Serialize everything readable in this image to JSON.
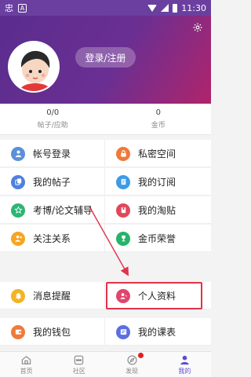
{
  "status_bar": {
    "time": "11:30",
    "app_icon": "忠"
  },
  "profile": {
    "login_label": "登录/注册"
  },
  "stats": [
    {
      "value": "0/0",
      "label": "帖子/应助"
    },
    {
      "value": "0",
      "label": "金币"
    }
  ],
  "menu": {
    "rows": [
      {
        "left": {
          "label": "帐号登录",
          "icon": "user-icon",
          "color": "#5b8fd9"
        },
        "right": {
          "label": "私密空间",
          "icon": "lock-icon",
          "color": "#f07a3a"
        }
      },
      {
        "left": {
          "label": "我的帖子",
          "icon": "copy-icon",
          "color": "#4f7fe0"
        },
        "right": {
          "label": "我的订阅",
          "icon": "book-icon",
          "color": "#3d9be6"
        }
      },
      {
        "left": {
          "label": "考博/论文辅导",
          "icon": "star-icon",
          "color": "#2bb673"
        },
        "right": {
          "label": "我的淘贴",
          "icon": "bookmark-icon",
          "color": "#e0485a"
        }
      },
      {
        "left": {
          "label": "关注关系",
          "icon": "follow-icon",
          "color": "#f5a623"
        },
        "right": {
          "label": "金币荣誉",
          "icon": "trophy-icon",
          "color": "#27b36a"
        }
      },
      {
        "left": {
          "label": "消息提醒",
          "icon": "bell-icon",
          "color": "#f5b323"
        },
        "right": {
          "label": "个人资料",
          "icon": "profile-icon",
          "color": "#e0456e"
        }
      },
      {
        "left": {
          "label": "我的钱包",
          "icon": "wallet-icon",
          "color": "#f07a3a"
        },
        "right": {
          "label": "我的课表",
          "icon": "schedule-icon",
          "color": "#5b6fe0"
        }
      }
    ]
  },
  "bottom_nav": [
    {
      "label": "首页",
      "icon": "home-icon",
      "active": false
    },
    {
      "label": "社区",
      "icon": "community-icon",
      "active": false
    },
    {
      "label": "发现",
      "icon": "compass-icon",
      "active": false
    },
    {
      "label": "我的",
      "icon": "person-icon",
      "active": true
    }
  ],
  "colors": {
    "header_start": "#5a2d8e",
    "header_end": "#b0246a",
    "highlight": "#e0334a",
    "active_tab": "#5b4bd6"
  }
}
